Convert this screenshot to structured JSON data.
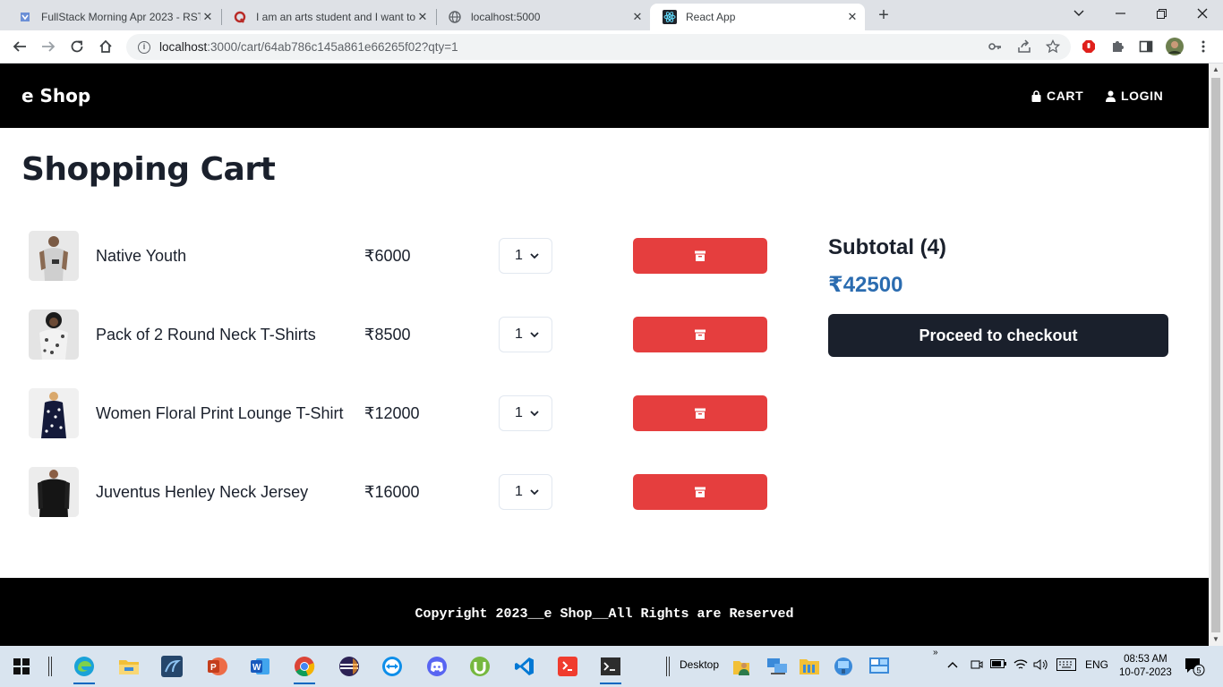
{
  "browser": {
    "tabs": [
      {
        "title": "FullStack Morning Apr 2023 - RST"
      },
      {
        "title": "I am an arts student and I want to"
      },
      {
        "title": "localhost:5000"
      },
      {
        "title": "React App"
      }
    ],
    "url_host": "localhost",
    "url_rest": ":3000/cart/64ab786c145a861e66265f02?qty=1"
  },
  "header": {
    "brand": "e Shop",
    "nav": [
      {
        "label": "CART",
        "icon": "lock-bag-icon"
      },
      {
        "label": "LOGIN",
        "icon": "user-icon"
      }
    ]
  },
  "cart": {
    "title": "Shopping Cart",
    "items": [
      {
        "name": "Native Youth",
        "price": "₹6000",
        "qty": "1"
      },
      {
        "name": "Pack of 2 Round Neck T-Shirts",
        "price": "₹8500",
        "qty": "1"
      },
      {
        "name": "Women Floral Print Lounge T-Shirt",
        "price": "₹12000",
        "qty": "1"
      },
      {
        "name": "Juventus Henley Neck Jersey",
        "price": "₹16000",
        "qty": "1"
      }
    ],
    "delete_icon": "archive-icon"
  },
  "summary": {
    "subtotal_label": "Subtotal (4)",
    "total": "₹42500",
    "checkout_label": "Proceed to checkout"
  },
  "footer": {
    "text": "Copyright 2023  e Shop  All Rights Are Reserved"
  },
  "taskbar": {
    "desktop_label": "Desktop",
    "lang": "ENG",
    "time": "08:53 AM",
    "date": "10-07-2023",
    "notifications": "5"
  },
  "colors": {
    "header_bg": "#000000",
    "delete_button": "#e53e3e",
    "checkout_button": "#1a202c",
    "total_text": "#2b6cb0"
  }
}
